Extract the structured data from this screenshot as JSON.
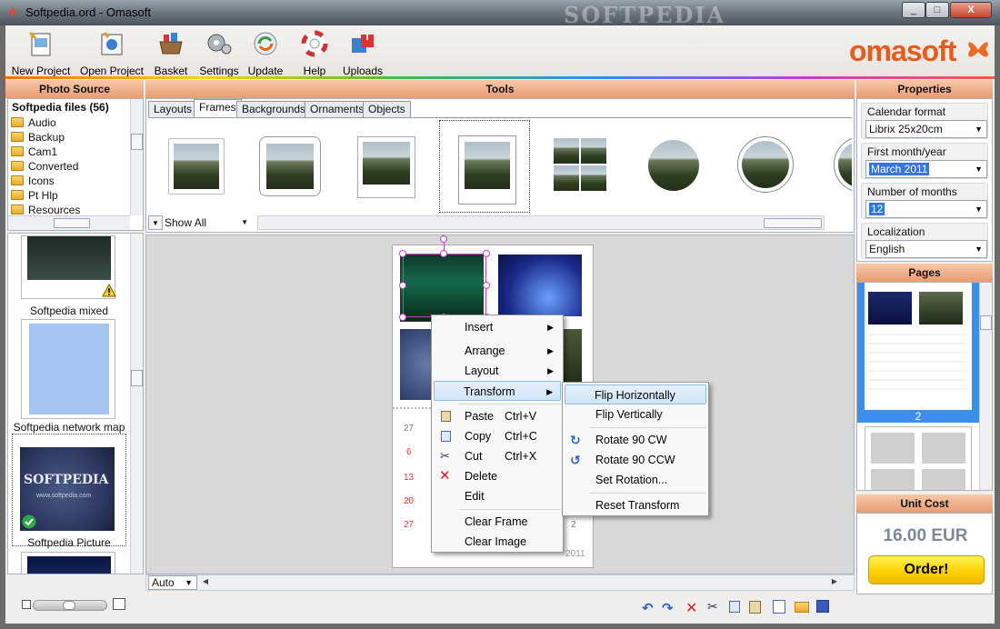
{
  "window": {
    "title": "Softpedia.ord - Omasoft",
    "minimize": "_",
    "maximize": "□",
    "close": "X"
  },
  "watermark": "SOFTPEDIA",
  "toolbar": {
    "items": [
      {
        "label": "New Project",
        "icon": "new-project-icon"
      },
      {
        "label": "Open Project",
        "icon": "open-project-icon"
      },
      {
        "label": "Basket",
        "icon": "basket-icon"
      },
      {
        "label": "Settings",
        "icon": "settings-icon"
      },
      {
        "label": "Update",
        "icon": "update-icon"
      },
      {
        "label": "Help",
        "icon": "help-icon"
      },
      {
        "label": "Uploads",
        "icon": "uploads-icon"
      }
    ],
    "brand": "omasoft"
  },
  "headers": {
    "photo_source": "Photo Source",
    "tools": "Tools",
    "properties": "Properties",
    "pages": "Pages",
    "unit_cost": "Unit Cost"
  },
  "photo_source": {
    "root": "Softpedia files (56)",
    "folders": [
      "Audio",
      "Backup",
      "Cam1",
      "Converted",
      "Icons",
      "Pt Hlp",
      "Resources"
    ],
    "thumbnails": [
      {
        "label": "Softpedia mixed",
        "badge": "warning"
      },
      {
        "label": "Softpedia network map",
        "badge": ""
      },
      {
        "label": "Softpedia Picture",
        "badge": "check"
      }
    ],
    "thumb_text": "SOFTPEDIA",
    "thumb_subtext": "www.softpedia.com"
  },
  "tools": {
    "tabs": [
      "Layouts",
      "Frames",
      "Backgrounds",
      "Ornaments",
      "Objects"
    ],
    "active_tab": "Frames",
    "show_all": "Show All"
  },
  "canvas": {
    "zoom": "Auto",
    "calendar_numbers": [
      "27",
      "6",
      "13",
      "20",
      "27"
    ],
    "calendar_side": "2",
    "calendar_year": "2011"
  },
  "context_menu": {
    "items": [
      {
        "label": "Insert",
        "submenu": true
      },
      {
        "label": "Arrange",
        "submenu": true
      },
      {
        "label": "Layout",
        "submenu": true
      },
      {
        "label": "Transform",
        "submenu": true,
        "highlighted": true
      },
      {
        "label": "Paste",
        "shortcut": "Ctrl+V",
        "icon": "paste-icon"
      },
      {
        "label": "Copy",
        "shortcut": "Ctrl+C",
        "icon": "copy-icon"
      },
      {
        "label": "Cut",
        "shortcut": "Ctrl+X",
        "icon": "cut-icon"
      },
      {
        "label": "Delete",
        "icon": "delete-icon"
      },
      {
        "label": "Edit"
      },
      {
        "label": "Clear Frame"
      },
      {
        "label": "Clear Image"
      }
    ]
  },
  "submenu": {
    "items": [
      {
        "label": "Flip Horizontally",
        "highlighted": true
      },
      {
        "label": "Flip Vertically"
      },
      {
        "label": "Rotate 90 CW",
        "icon": "rotate-cw-icon"
      },
      {
        "label": "Rotate 90 CCW",
        "icon": "rotate-ccw-icon"
      },
      {
        "label": "Set Rotation..."
      },
      {
        "label": "Reset Transform"
      }
    ]
  },
  "properties": {
    "calendar_format": {
      "label": "Calendar format",
      "value": "Librix 25x20cm"
    },
    "first_month": {
      "label": "First month/year",
      "value": "March 2011"
    },
    "number_of_months": {
      "label": "Number of months",
      "value": "12"
    },
    "localization": {
      "label": "Localization",
      "value": "English"
    }
  },
  "pages": {
    "selected_page": "2"
  },
  "unit_cost": {
    "price": "16.00 EUR",
    "order_label": "Order!"
  },
  "colors": {
    "accent": "#e79d73",
    "brand": "#ea5a1a",
    "selection": "#3875d7",
    "order": "#ffd700"
  }
}
